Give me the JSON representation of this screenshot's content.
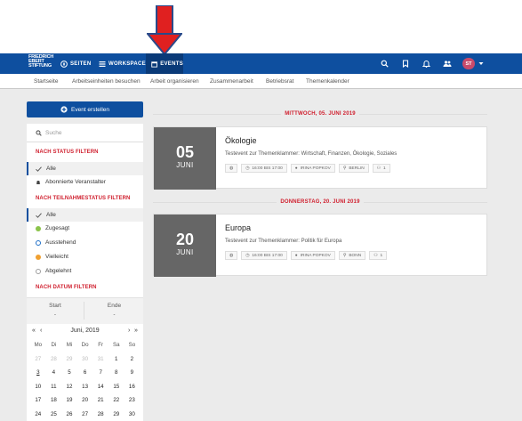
{
  "logo": {
    "lines": [
      "FRIEDRICH",
      "EBERT",
      "STIFTUNG"
    ]
  },
  "nav": [
    {
      "label": "SEITEN",
      "icon": "compass-icon"
    },
    {
      "label": "WORKSPACES",
      "icon": "list-icon"
    },
    {
      "label": "EVENTS",
      "icon": "calendar-icon",
      "active": true
    }
  ],
  "user": {
    "initials": "ST"
  },
  "subnav": [
    "Startseite",
    "Arbeitseinheiten besuchen",
    "Arbeit organisieren",
    "Zusammenarbeit",
    "Betriebsrat",
    "Themenkalender"
  ],
  "sidebar": {
    "create_label": "Event erstellen",
    "search_placeholder": "Suche",
    "status_heading": "NACH STATUS FILTERN",
    "status_options": [
      "Alle",
      "Abonnierte Veranstalter"
    ],
    "participation_heading": "NACH TEILNAHMESTATUS FILTERN",
    "participation_options": [
      {
        "label": "Alle",
        "color": ""
      },
      {
        "label": "Zugesagt",
        "color": "#8bc34a"
      },
      {
        "label": "Ausstehend",
        "color": "#1e6fc7"
      },
      {
        "label": "Vielleicht",
        "color": "#f0a030"
      },
      {
        "label": "Abgelehnt",
        "color": "#9e9e9e"
      }
    ],
    "date_heading": "NACH DATUM FILTERN",
    "start_label": "Start",
    "start_value": "-",
    "end_label": "Ende",
    "end_value": "-"
  },
  "calendar": {
    "nav_prev2": "«",
    "nav_prev": "‹",
    "month": "Juni, 2019",
    "nav_next": "›",
    "nav_next2": "»",
    "weekdays": [
      "Mo",
      "Di",
      "Mi",
      "Do",
      "Fr",
      "Sa",
      "So"
    ],
    "days": [
      "27",
      "28",
      "29",
      "30",
      "31",
      "1",
      "2",
      "3",
      "4",
      "5",
      "6",
      "7",
      "8",
      "9",
      "10",
      "11",
      "12",
      "13",
      "14",
      "15",
      "16",
      "17",
      "18",
      "19",
      "20",
      "21",
      "22",
      "23",
      "24",
      "25",
      "26",
      "27",
      "28",
      "29",
      "30"
    ],
    "dim_count": 5,
    "today": "3"
  },
  "events": [
    {
      "date_header": "MITTWOCH, 05. JUNI 2019",
      "day": "05",
      "month": "JUNI",
      "title": "Ökologie",
      "description": "Testevent zur Themenklammer: Wirtschaft, Finanzen, Ökologie, Soziales",
      "time": "16:00 BIS 17:00",
      "person": "IRINA POPKOV",
      "location": "BERLIN",
      "participants": "1"
    },
    {
      "date_header": "DONNERSTAG, 20. JUNI 2019",
      "day": "20",
      "month": "JUNI",
      "title": "Europa",
      "description": "Testevent zur Themenklammer: Politik für Europa",
      "time": "16:00 BIS 17:00",
      "person": "IRINA POPKOV",
      "location": "BONN",
      "participants": "1"
    }
  ],
  "colors": {
    "brand": "#0e4f9f",
    "accent_red": "#d0202f",
    "arrow": "#e02020"
  }
}
